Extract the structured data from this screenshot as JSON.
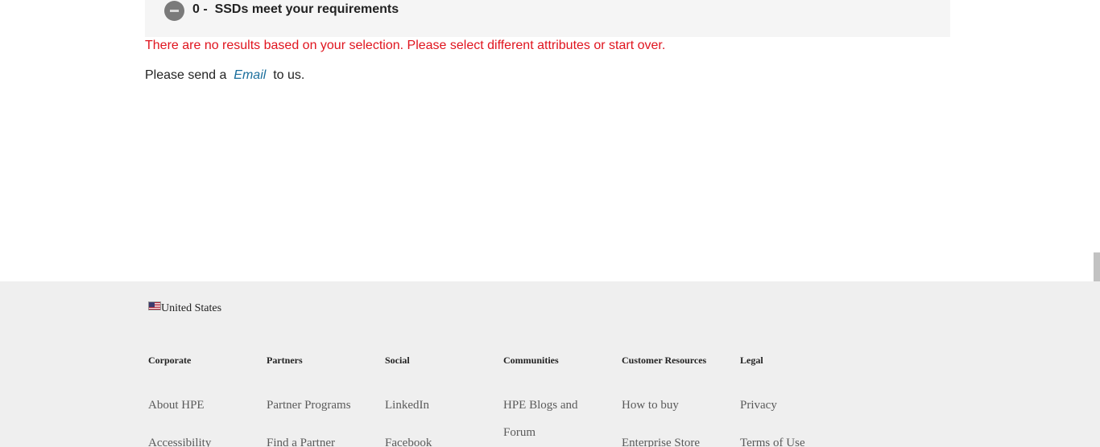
{
  "results": {
    "count": "0",
    "separator": " -  ",
    "title": "SSDs meet your requirements",
    "no_results_message": "There are no results based on your selection. Please select different attributes or start over.",
    "send_prefix": "Please send a  ",
    "email_link": "Email",
    "send_suffix": "  to us."
  },
  "footer": {
    "country": "United States",
    "columns": [
      {
        "heading": "Corporate",
        "links": [
          "About HPE",
          "Accessibility"
        ]
      },
      {
        "heading": "Partners",
        "links": [
          "Partner Programs",
          "Find a Partner"
        ]
      },
      {
        "heading": "Social",
        "links": [
          "LinkedIn",
          "Facebook"
        ]
      },
      {
        "heading": "Communities",
        "links": [
          "HPE Blogs and Forum"
        ]
      },
      {
        "heading": "Customer Resources",
        "links": [
          "How to buy",
          "Enterprise Store"
        ]
      },
      {
        "heading": "Legal",
        "links": [
          "Privacy",
          "Terms of Use"
        ]
      }
    ]
  },
  "colors": {
    "error_text": "#e0141e",
    "link": "#1a6e9c",
    "footer_bg": "#efefef",
    "header_bg": "#f5f5f5"
  }
}
